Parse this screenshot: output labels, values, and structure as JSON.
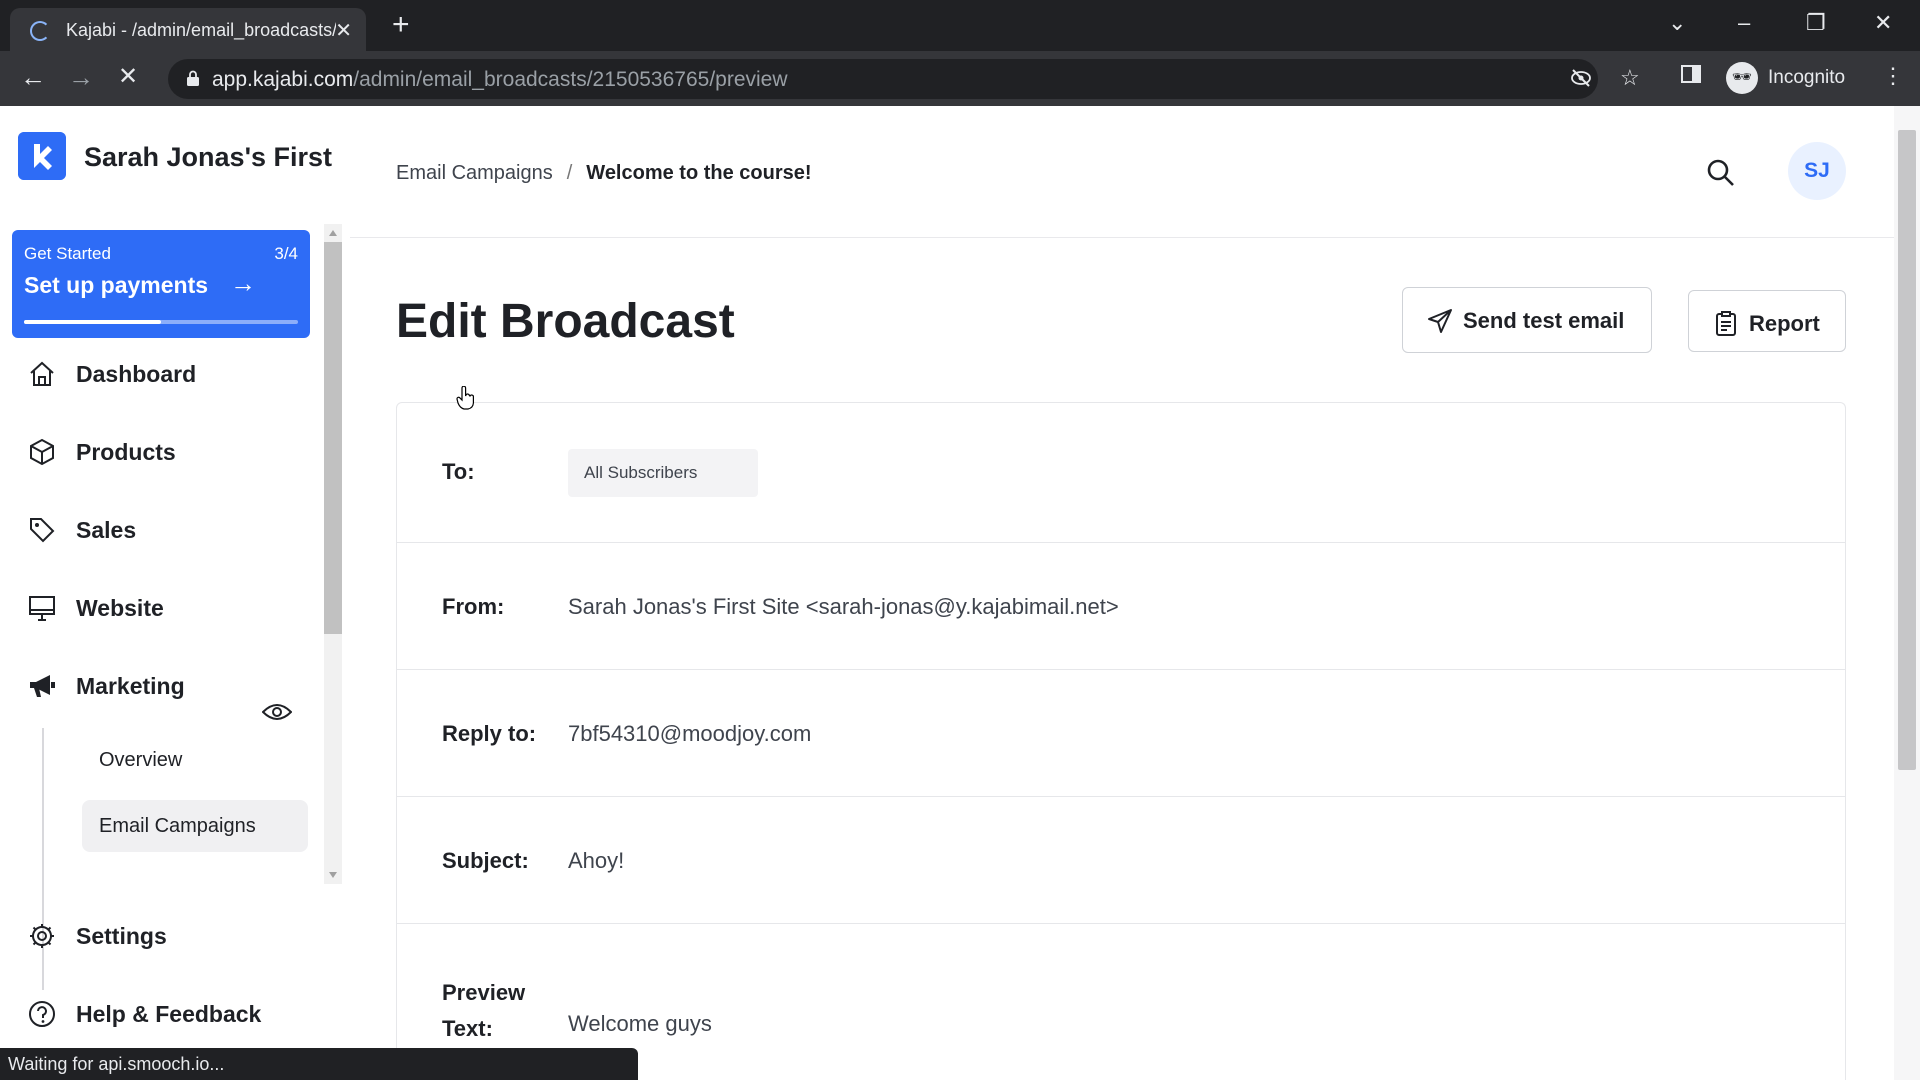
{
  "browser": {
    "tab_title": "Kajabi - /admin/email_broadcasts/",
    "url_host": "app.kajabi.com",
    "url_path": "/admin/email_broadcasts/2150536765/preview",
    "incognito_label": "Incognito",
    "status_text": "Waiting for api.smooch.io..."
  },
  "sidebar": {
    "brand_name": "Sarah Jonas's First",
    "get_started": {
      "label": "Get Started",
      "count": "3/4",
      "title": "Set up payments",
      "progress_fraction": 0.5
    },
    "items": [
      {
        "label": "Dashboard",
        "icon": "home-icon"
      },
      {
        "label": "Products",
        "icon": "box-icon"
      },
      {
        "label": "Sales",
        "icon": "tag-icon"
      },
      {
        "label": "Website",
        "icon": "monitor-icon"
      },
      {
        "label": "Marketing",
        "icon": "megaphone-icon"
      },
      {
        "label": "Settings",
        "icon": "gear-icon"
      },
      {
        "label": "Help & Feedback",
        "icon": "help-icon"
      }
    ],
    "marketing_sub": [
      {
        "label": "Overview"
      },
      {
        "label": "Email Campaigns",
        "active": true
      }
    ]
  },
  "header": {
    "breadcrumb_parent": "Email Campaigns",
    "breadcrumb_separator": "/",
    "breadcrumb_current": "Welcome to the course!",
    "avatar_initials": "SJ"
  },
  "main": {
    "title": "Edit Broadcast",
    "send_test_label": "Send test email",
    "report_label": "Report",
    "fields": {
      "to_label": "To:",
      "to_value": "All Subscribers",
      "from_label": "From:",
      "from_value": "Sarah Jonas's First Site <sarah-jonas@y.kajabimail.net>",
      "reply_label": "Reply to:",
      "reply_value": "7bf54310@moodjoy.com",
      "subject_label": "Subject:",
      "subject_value": "Ahoy!",
      "preview_label_1": "Preview",
      "preview_label_2": "Text:",
      "preview_value": "Welcome guys"
    }
  },
  "colors": {
    "brand_blue": "#2e6cf6",
    "chrome_dark": "#202124",
    "chrome_toolbar": "#35363a"
  }
}
